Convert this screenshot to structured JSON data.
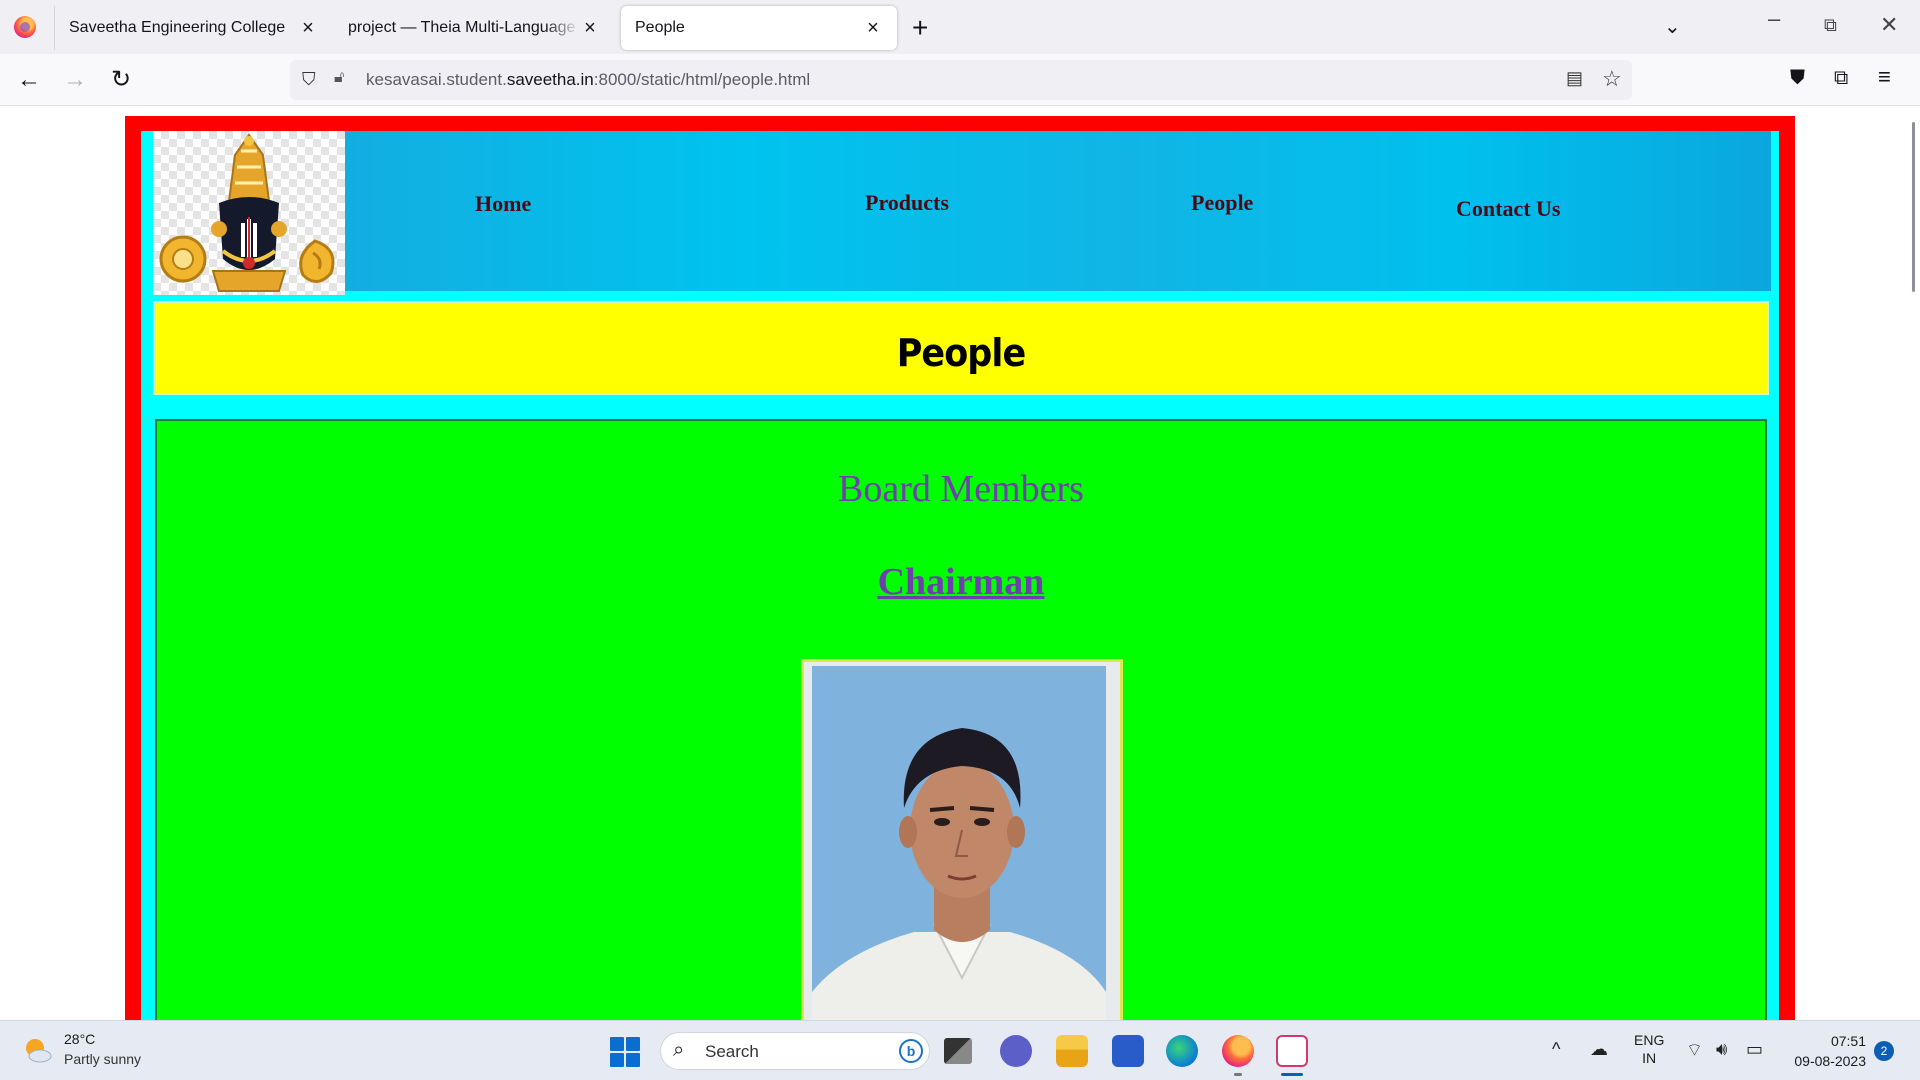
{
  "browser": {
    "tabs": [
      {
        "title": "Saveetha Engineering College"
      },
      {
        "title": "project — Theia Multi-Language Explorer"
      },
      {
        "title": "People"
      }
    ],
    "url": {
      "prefix": "kesavasai.student.",
      "host": "saveetha.in",
      "suffix": ":8000/static/html/people.html"
    }
  },
  "site": {
    "nav": {
      "home": "Home",
      "products": "Products",
      "people": "People",
      "contact": "Contact Us"
    },
    "page_title": "People",
    "section_heading": "Board Members",
    "role_heading": "Chairman",
    "colors": {
      "frame": "#ff0000",
      "inner": "#00ffff",
      "title_band": "#ffff00",
      "content": "#00ff00",
      "heading_text": "#6f3fae",
      "nav_text": "#4a0a14"
    }
  },
  "taskbar": {
    "weather": {
      "temp": "28°C",
      "desc": "Partly sunny"
    },
    "search_label": "Search",
    "language": {
      "line1": "ENG",
      "line2": "IN"
    },
    "clock": {
      "time": "07:51",
      "date": "09-08-2023"
    },
    "notification_count": "2"
  }
}
